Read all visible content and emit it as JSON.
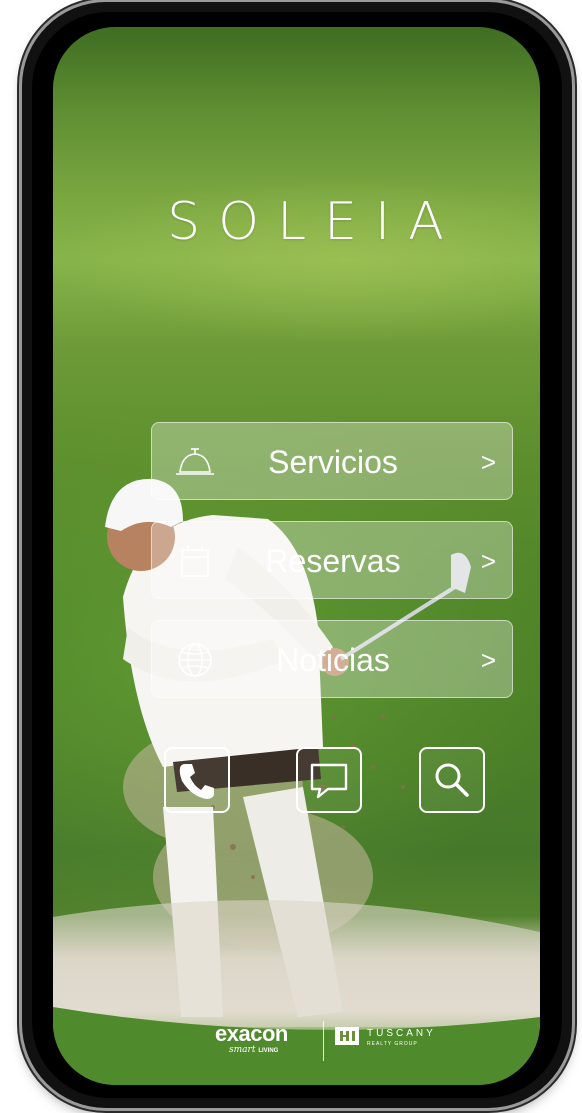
{
  "app": {
    "brand_name": "SOLEIA"
  },
  "menu": {
    "items": [
      {
        "label": "Servicios",
        "arrow": ">",
        "icon": "service-bell-icon"
      },
      {
        "label": "Reservas",
        "arrow": ">",
        "icon": "calendar-icon"
      },
      {
        "label": "Noticias",
        "arrow": ">",
        "icon": "globe-icon"
      }
    ]
  },
  "quick_actions": [
    {
      "icon": "phone-icon"
    },
    {
      "icon": "chat-icon"
    },
    {
      "icon": "search-icon"
    }
  ],
  "footer": {
    "exacon_logo": "exacon",
    "exacon_tagline_script": "smart",
    "exacon_tagline_caps": "LIVING",
    "tuscany_logo": "TUSCANY",
    "tuscany_tagline": "REALTY GROUP"
  },
  "colors": {
    "text": "#ffffff",
    "button_fill": "rgba(255,255,255,0.30)",
    "grass": "#5b8d2c"
  }
}
